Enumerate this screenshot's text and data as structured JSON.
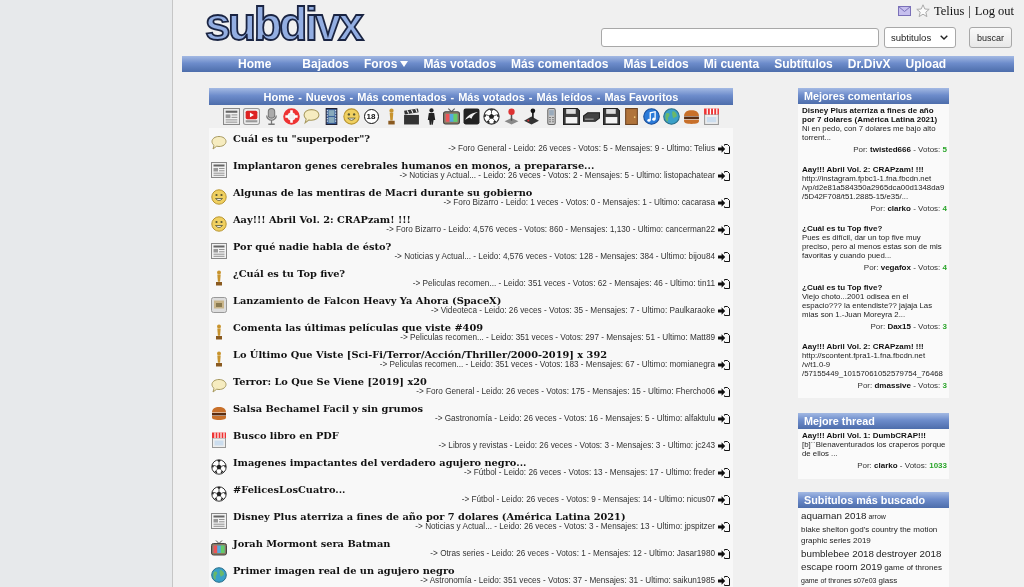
{
  "header": {
    "logo": "subdivx",
    "user": "Telius",
    "separator": "|",
    "logout": "Log out",
    "search": {
      "scope": "subtitulos",
      "button": "buscar"
    }
  },
  "nav": [
    {
      "label": "Home",
      "dropdown": false
    },
    {
      "label": "Bajados",
      "dropdown": false
    },
    {
      "label": "Foros",
      "dropdown": true
    },
    {
      "label": "Más votados",
      "dropdown": false
    },
    {
      "label": "Más comentados",
      "dropdown": false
    },
    {
      "label": "Más Leidos",
      "dropdown": false
    },
    {
      "label": "Mi cuenta",
      "dropdown": false
    },
    {
      "label": "Subtítulos",
      "dropdown": false
    },
    {
      "label": "Dr.DivX",
      "dropdown": false
    },
    {
      "label": "Upload",
      "dropdown": false
    }
  ],
  "forum": {
    "links": [
      "Home",
      "Nuevos",
      "Más comentados",
      "Más votados",
      "Más leídos",
      "Mas Favoritos"
    ],
    "separator": "-",
    "categories": [
      {
        "kind": "news"
      },
      {
        "kind": "youtube"
      },
      {
        "kind": "mic"
      },
      {
        "kind": "lifebuoy"
      },
      {
        "kind": "chat"
      },
      {
        "kind": "film"
      },
      {
        "kind": "smiley"
      },
      {
        "kind": "age",
        "text": "18"
      },
      {
        "kind": "oscar"
      },
      {
        "kind": "clapper"
      },
      {
        "kind": "figure"
      },
      {
        "kind": "tv"
      },
      {
        "kind": "wing"
      },
      {
        "kind": "soccer"
      },
      {
        "kind": "joystick"
      },
      {
        "kind": "arcade"
      },
      {
        "kind": "phone"
      },
      {
        "kind": "floppy"
      },
      {
        "kind": "drive"
      },
      {
        "kind": "floppy"
      },
      {
        "kind": "door"
      },
      {
        "kind": "music"
      },
      {
        "kind": "globe"
      },
      {
        "kind": "burger"
      },
      {
        "kind": "shop"
      }
    ],
    "threads": [
      {
        "kind": "chat",
        "title": "Cuál es tu \"superpoder\"?",
        "meta": "-> Foro General - Leido: 26 veces - Votos: 5 - Mensajes: 9 - Ultimo: Telius"
      },
      {
        "kind": "news",
        "title": "Implantaron genes cerebrales humanos en monos, a prepararse...",
        "meta": "-> Noticias y Actual... - Leido: 26 veces - Votos: 2 - Mensajes: 5 - Ultimo: listopachatear"
      },
      {
        "kind": "smiley",
        "title": "Algunas de las mentiras de Macri durante su gobierno",
        "meta": "-> Foro Bizarro - Leido: 1 veces - Votos: 0 - Mensajes: 1 - Ultimo: cacarasa"
      },
      {
        "kind": "smiley",
        "title": "Aay!!! Abril Vol. 2: CRAPzam! !!!",
        "meta": "-> Foro Bizarro - Leido: 4,576 veces - Votos: 860 - Mensajes: 1,130 - Ultimo: cancerman22"
      },
      {
        "kind": "news",
        "title": "Por qué nadie habla de ésto?",
        "meta": "-> Noticias y Actual... - Leido: 4,576 veces - Votos: 128 - Mensajes: 384 - Ultimo: bijou84"
      },
      {
        "kind": "oscar",
        "title": "¿Cuál es tu Top five?",
        "meta": "-> Peliculas recomen... - Leido: 351 veces - Votos: 62 - Mensajes: 46 - Ultimo: tin11"
      },
      {
        "kind": "video",
        "title": "Lanzamiento de Falcon Heavy Ya Ahora (SpaceX)",
        "meta": "-> Videoteca - Leido: 26 veces - Votos: 35 - Mensajes: 7 - Ultimo: Paulkaraoke"
      },
      {
        "kind": "oscar",
        "title": "Comenta las últimas películas que viste #409",
        "meta": "-> Peliculas recomen... - Leido: 351 veces - Votos: 297 - Mensajes: 51 - Ultimo: Matt89"
      },
      {
        "kind": "oscar",
        "title": "Lo Último Que Viste [Sci-Fi/Terror/Acción/Thriller/2000-2019] x 392",
        "meta": "-> Peliculas recomen... - Leido: 351 veces - Votos: 183 - Mensajes: 67 - Ultimo: momianegra"
      },
      {
        "kind": "chat",
        "title": "Terror: Lo Que Se Viene [2019] x20",
        "meta": "-> Foro General - Leido: 26 veces - Votos: 175 - Mensajes: 15 - Ultimo: Fhercho06"
      },
      {
        "kind": "burger",
        "title": "Salsa Bechamel Facil y sin grumos",
        "meta": "-> Gastronomía - Leido: 26 veces - Votos: 16 - Mensajes: 5 - Ultimo: alfaktulu"
      },
      {
        "kind": "shop",
        "title": "Busco libro en PDF",
        "meta": "-> Libros y revistas - Leido: 26 veces - Votos: 3 - Mensajes: 3 - Ultimo: jc243"
      },
      {
        "kind": "soccer",
        "title": "Imagenes impactantes del verdadero agujero negro...",
        "meta": "-> Fútbol - Leido: 26 veces - Votos: 13 - Mensajes: 17 - Ultimo: freder"
      },
      {
        "kind": "soccer",
        "title": "#FelicesLosCuatro...",
        "meta": "-> Fútbol - Leido: 26 veces - Votos: 9 - Mensajes: 14 - Ultimo: nicus07"
      },
      {
        "kind": "news",
        "title": "Disney Plus aterriza a fines de año por 7 dolares (América Latina 2021)",
        "meta": "-> Noticias y Actual... - Leido: 26 veces - Votos: 3 - Mensajes: 13 - Ultimo: jpspitzer"
      },
      {
        "kind": "tv",
        "title": "Jorah Mormont sera Batman",
        "meta": "-> Otras series - Leido: 26 veces - Votos: 1 - Mensajes: 12 - Ultimo: Jasar1980"
      },
      {
        "kind": "globe",
        "title": "Primer imagen real de un agujero negro",
        "meta": "-> Astronomía - Leido: 351 veces - Votos: 37 - Mensajes: 31 - Ultimo: saikun1985"
      }
    ]
  },
  "sidebar": {
    "best_comments": {
      "title": "Mejores comentarios",
      "items": [
        {
          "title": "Disney Plus aterriza a fines de año por 7 dolares (América Latina 2021)",
          "text": "Ni en pedo, con 7 dolares me bajo alto torrent...",
          "by_label": "Por:",
          "author": "twisted666",
          "votes_label": "- Votos:",
          "votes": "5"
        },
        {
          "title": "Aay!!! Abril Vol. 2: CRAPzam! !!!",
          "text": "http://instagram.fpbc1-1.fna.fbcdn.net /vp/d2e81a584350a2965dca00d1348da9 /5D42F708/t51.2885-15/e35/...",
          "by_label": "Por:",
          "author": "clarko",
          "votes_label": "- Votos:",
          "votes": "4"
        },
        {
          "title": "¿Cuál es tu Top five?",
          "text": "Pues es difícil, dar un top five muy preciso, pero al menos estas son de mis favoritas y cuando pued...",
          "by_label": "Por:",
          "author": "vegafox",
          "votes_label": "- Votos:",
          "votes": "4"
        },
        {
          "title": "¿Cuál es tu Top five?",
          "text": "Viejo choto...2001 odisea en el espacio??? la entendiste?? jajaja Las mias son 1.-Juan Moreyra 2...",
          "by_label": "Por:",
          "author": "Dax15",
          "votes_label": "- Votos:",
          "votes": "3"
        },
        {
          "title": "Aay!!! Abril Vol. 2: CRAPzam! !!!",
          "text": "http://scontent.fpra1-1.fna.fbcdn.net /v/t1.0-9 /57155449_10157061052579754_76468",
          "by_label": "Por:",
          "author": "dmassive",
          "votes_label": "- Votos:",
          "votes": "3"
        }
      ]
    },
    "best_thread": {
      "title": "Mejore thread",
      "item": {
        "title": "Aay!!! Abril Vol. 1: DumbCRAP!!!",
        "text": "[b]´´Bienaventurados los craperos porque de ellos ...",
        "by_label": "Por:",
        "author": "clarko",
        "votes_label": "- Votos:",
        "votes": "1033"
      }
    },
    "most_searched": {
      "title": "Subitulos más buscado",
      "tags": [
        {
          "label": "aquaman 2018",
          "kind": "large"
        },
        {
          "label": "arrow",
          "kind": "small"
        },
        {
          "label": "blake shelton god's country the motion graphic series 2019",
          "kind": "medium"
        },
        {
          "label": "bumblebee 2018",
          "kind": "large"
        },
        {
          "label": "destroyer 2018",
          "kind": "large"
        },
        {
          "label": "escape room 2019",
          "kind": "large"
        },
        {
          "label": "game of thrones",
          "kind": "medium"
        },
        {
          "label": "game of thrones s07e03",
          "kind": "small"
        },
        {
          "label": "glass",
          "kind": "medium"
        }
      ]
    }
  }
}
